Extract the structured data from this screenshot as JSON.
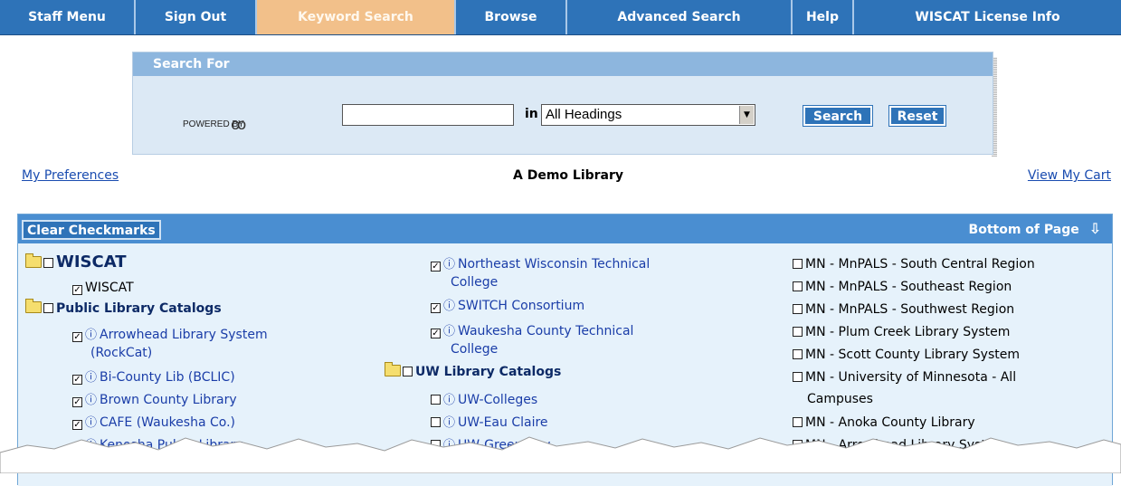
{
  "nav": {
    "items": [
      {
        "label": "Staff Menu"
      },
      {
        "label": "Sign Out"
      },
      {
        "label": "Keyword Search"
      },
      {
        "label": "Browse"
      },
      {
        "label": "Advanced Search"
      },
      {
        "label": "Help"
      },
      {
        "label": "WISCAT License Info"
      }
    ],
    "active": "Keyword Search"
  },
  "search": {
    "header": "Search For",
    "powered_by": "POWERED BY",
    "logo_glyph": "ꝏ",
    "query_value": "",
    "in_label": "in",
    "field_selected": "All Headings",
    "search_button": "Search",
    "reset_button": "Reset"
  },
  "links": {
    "preferences": "My Preferences",
    "library_name": "A Demo Library",
    "cart": "View My Cart"
  },
  "catalogs": {
    "clear_button": "Clear Checkmarks",
    "bottom_link": "Bottom of Page",
    "col1": [
      {
        "text": "WISCAT",
        "kind": "title",
        "checked": false
      },
      {
        "text": "WISCAT",
        "kind": "item",
        "checked": true
      },
      {
        "text": "Public Library Catalogs",
        "kind": "group",
        "checked": false
      },
      {
        "text": "Arrowhead Library System",
        "kind": "link",
        "checked": true
      },
      {
        "text": "(RockCat)",
        "kind": "cont"
      },
      {
        "text": "Bi-County Lib (BCLIC)",
        "kind": "link",
        "checked": true
      },
      {
        "text": "Brown County Library",
        "kind": "link",
        "checked": true
      },
      {
        "text": "CAFE (Waukesha Co.)",
        "kind": "link",
        "checked": true
      },
      {
        "text": "Kenosha Public Library",
        "kind": "link",
        "checked": true
      }
    ],
    "col2": [
      {
        "text": "Northeast Wisconsin Technical",
        "kind": "link",
        "checked": true
      },
      {
        "text": "College",
        "kind": "cont"
      },
      {
        "text": "SWITCH Consortium",
        "kind": "link",
        "checked": true
      },
      {
        "text": "Waukesha County Technical",
        "kind": "link",
        "checked": true
      },
      {
        "text": "College",
        "kind": "cont"
      },
      {
        "text": "UW Library Catalogs",
        "kind": "group",
        "checked": false
      },
      {
        "text": "UW-Colleges",
        "kind": "link",
        "checked": false
      },
      {
        "text": "UW-Eau Claire",
        "kind": "link",
        "checked": false
      },
      {
        "text": "UW-Green Bay",
        "kind": "link",
        "checked": false
      }
    ],
    "col3": [
      {
        "text": "MN - MnPALS - South Central Region",
        "checked": false
      },
      {
        "text": "MN - MnPALS - Southeast Region",
        "checked": false
      },
      {
        "text": "MN - MnPALS - Southwest Region",
        "checked": false
      },
      {
        "text": "MN - Plum Creek Library System",
        "checked": false
      },
      {
        "text": "MN - Scott County Library System",
        "checked": false
      },
      {
        "text": "MN - University of Minnesota - All",
        "checked": false
      },
      {
        "text": "Campuses",
        "kind": "cont"
      },
      {
        "text": "MN - Anoka County Library",
        "checked": false
      },
      {
        "text": "MN - Arrowhead Library System",
        "checked": false
      }
    ]
  },
  "colors": {
    "nav_bg": "#2e73b8",
    "nav_active": "#f2c08a",
    "panel_bg": "#dce9f5",
    "link": "#1a3da8"
  }
}
